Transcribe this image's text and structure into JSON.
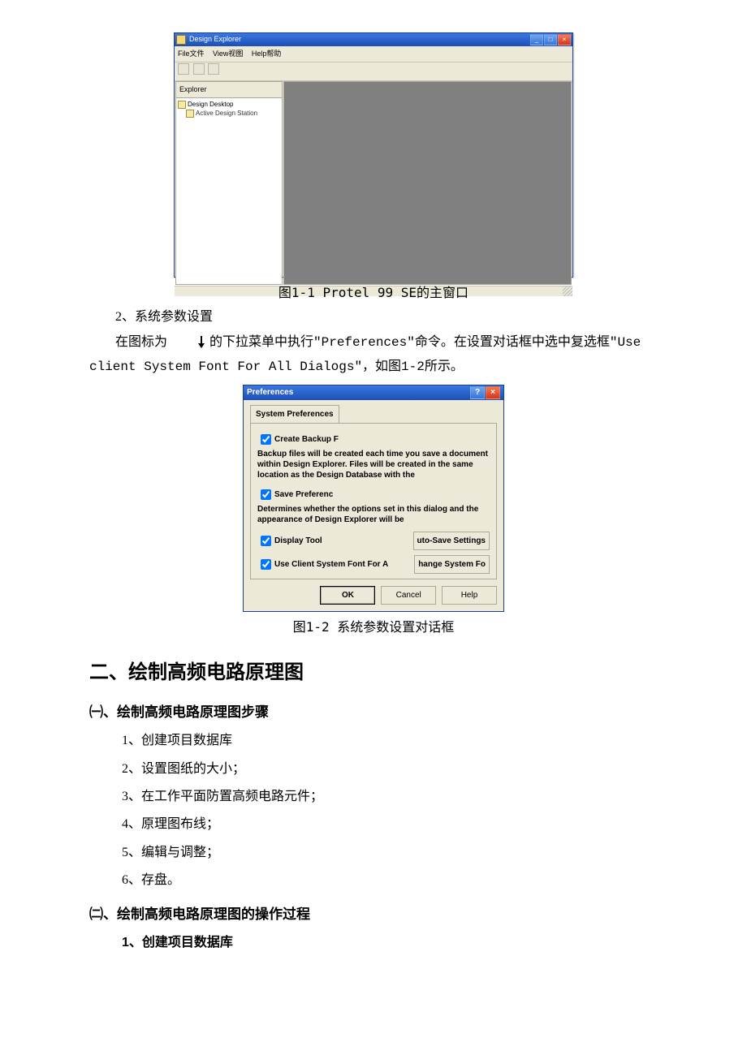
{
  "fig1": {
    "window_title": "Design Explorer",
    "menu": {
      "file": "File文件",
      "view": "View视图",
      "help": "Help帮助"
    },
    "explorer_tab": "Explorer",
    "tree": {
      "root": "Design Desktop",
      "child": "Active Design Station"
    },
    "caption": "图1-1 Protel 99 SE的主窗口"
  },
  "text": {
    "section2": "2、系统参数设置",
    "para_a": "在图标为 ",
    "para_b": " 的下拉菜单中执行\"Preferences\"命令。在设置对话框中选中复选框\"Use client System Font For All Dialogs\"，如图1-2所示。"
  },
  "fig2": {
    "title": "Preferences",
    "tab": "System Preferences",
    "chk_backup": "Create Backup F",
    "desc_backup": "Backup files will be created each time you save a document within Design Explorer. Files will be created in the same location as the Design Database with the",
    "chk_save": "Save Preferenc",
    "desc_save": "Determines whether the options set in this dialog and the appearance of Design Explorer will be",
    "chk_display": "Display Tool",
    "btn_autosave": "uto-Save Settings",
    "chk_usefont": "Use Client System Font For A",
    "btn_changefont": "hange System Fo",
    "ok": "OK",
    "cancel": "Cancel",
    "help": "Help",
    "caption": "图1-2  系统参数设置对话框"
  },
  "h2": "二、绘制高频电路原理图",
  "sub1": {
    "title": "㈠、绘制高频电路原理图步骤",
    "s1": "1、创建项目数据库",
    "s2": "2、设置图纸的大小；",
    "s3": "3、在工作平面防置高频电路元件；",
    "s4": "4、原理图布线；",
    "s5": "5、编辑与调整；",
    "s6": "6、存盘。"
  },
  "sub2": {
    "title": "㈡、绘制高频电路原理图的操作过程",
    "s1": "1、创建项目数据库"
  }
}
